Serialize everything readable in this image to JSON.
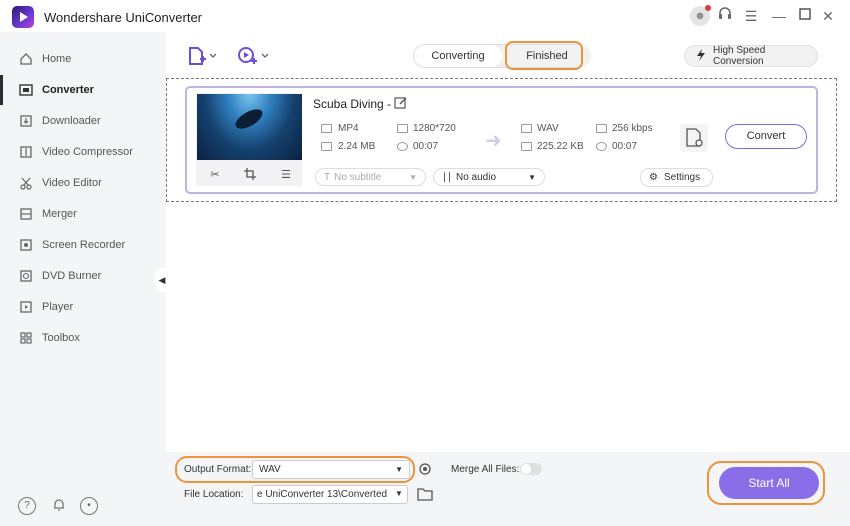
{
  "app": {
    "title": "Wondershare UniConverter"
  },
  "sidebar": {
    "items": [
      {
        "label": "Home",
        "icon": "home-icon"
      },
      {
        "label": "Converter",
        "icon": "converter-icon",
        "active": true
      },
      {
        "label": "Downloader",
        "icon": "download-icon"
      },
      {
        "label": "Video Compressor",
        "icon": "compress-icon"
      },
      {
        "label": "Video Editor",
        "icon": "scissors-icon"
      },
      {
        "label": "Merger",
        "icon": "merge-icon"
      },
      {
        "label": "Screen Recorder",
        "icon": "record-icon"
      },
      {
        "label": "DVD Burner",
        "icon": "disc-icon"
      },
      {
        "label": "Player",
        "icon": "play-icon"
      },
      {
        "label": "Toolbox",
        "icon": "grid-icon"
      }
    ]
  },
  "tabs": {
    "converting": "Converting",
    "finished": "Finished"
  },
  "toolbar": {
    "high_speed": "High Speed Conversion"
  },
  "file": {
    "name": "Scuba Diving -",
    "source": {
      "format": "MP4",
      "resolution": "1280*720",
      "size": "2.24 MB",
      "duration": "00:07"
    },
    "target": {
      "format": "WAV",
      "bitrate": "256 kbps",
      "size": "225.22 KB",
      "duration": "00:07"
    },
    "convert_label": "Convert",
    "subtitle": "No subtitle",
    "audio": "No audio",
    "settings_label": "Settings"
  },
  "bottom": {
    "output_format_label": "Output Format:",
    "output_format_value": "WAV",
    "merge_label": "Merge All Files:",
    "file_location_label": "File Location:",
    "file_location_value": "e UniConverter 13\\Converted",
    "start_all_label": "Start All"
  },
  "colors": {
    "accent": "#8a6ee8",
    "highlight": "#f0923a"
  }
}
